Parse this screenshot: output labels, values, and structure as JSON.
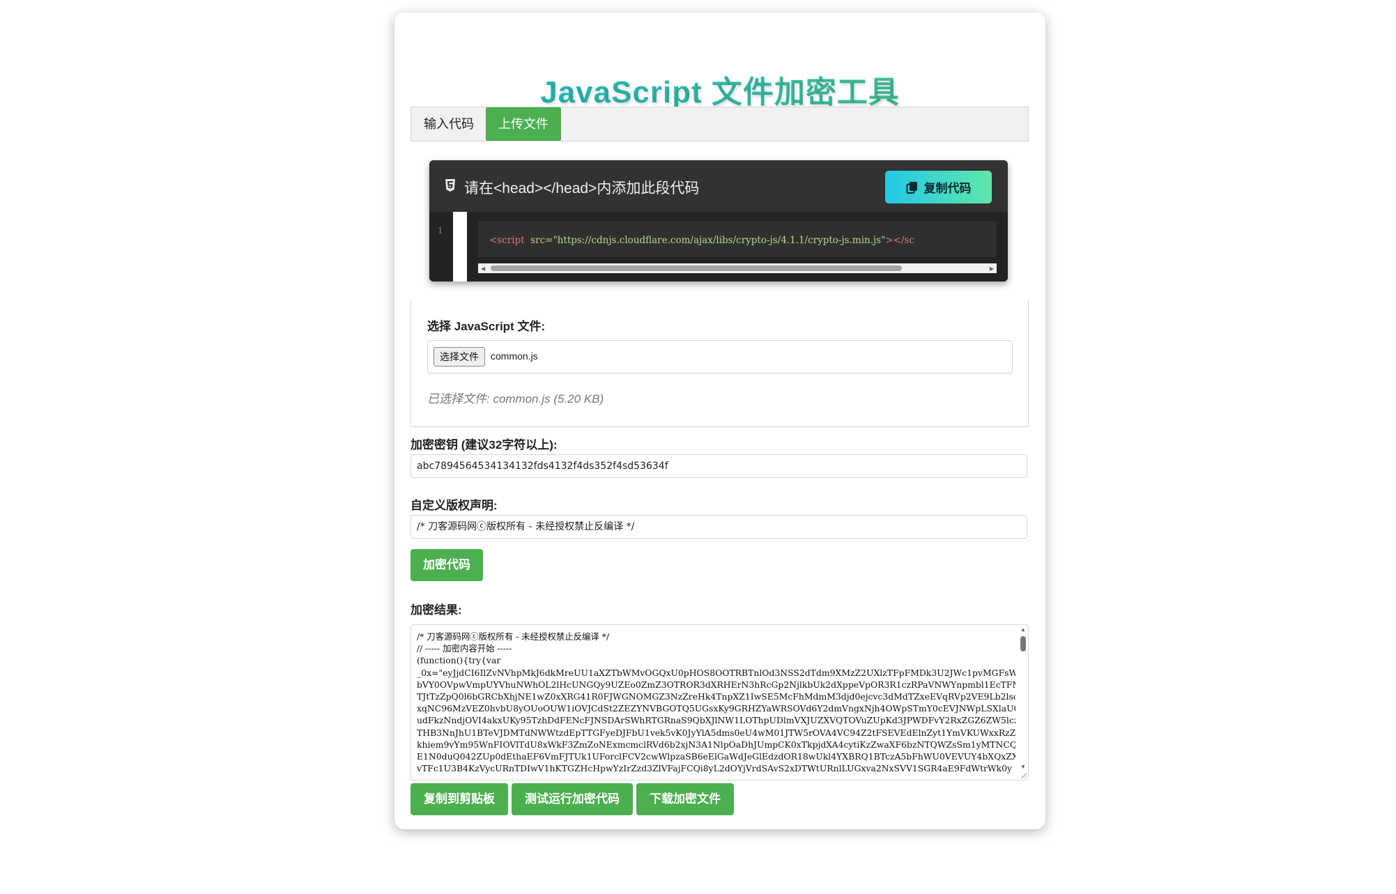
{
  "title": "JavaScript 文件加密工具",
  "tabs": [
    {
      "label": "输入代码"
    },
    {
      "label": "上传文件"
    }
  ],
  "code_snippet": {
    "title": "请在<head></head>内添加此段代码",
    "copy_label": "复制代码",
    "line_number": "1",
    "tag_open": "<script",
    "attr": "src=",
    "url": "\"https://cdnjs.cloudflare.com/ajax/libs/crypto-js/4.1.1/crypto-js.min.js\"",
    "tag_close": "></sc"
  },
  "upload": {
    "label": "选择 JavaScript 文件:",
    "button_label": "选择文件",
    "file_name": "common.js",
    "selected_text": "已选择文件: common.js (5.20 KB)"
  },
  "key": {
    "label": "加密密钥 (建议32字符以上):",
    "value": "abc7894564534134132fds4132f4ds352f4sd53634f"
  },
  "copyright": {
    "label": "自定义版权声明:",
    "value": "/* 刀客源码网ⓒ版权所有 - 未经授权禁止反编译 */"
  },
  "encrypt_button": "加密代码",
  "result": {
    "label": "加密结果:",
    "text": "/* 刀客源码网ⓒ版权所有 - 未经授权禁止反编译 */\n// ----- 加密内容开始 -----\n(function(){try{var\n_0x=\"eyJjdCI6IlZvNVhpMkJ6dkMreUU1aXZTbWMvOGQxU0pHOS8OOTRBTnlOd3NSS2dTdm9XMzZ2UXlzTFpFMDk3U2JWc1pvMGFsWVJ1\nbVY0OVpwVmpUYVhuNWhOL2lHcUNGQy9UZEo0ZmZ3OTROR3dXRHErN3hRcGp2NjlkbUk2dXppeVpOR3R1czRPaVNWYnpmbl1EcTFMSEVvO\nTJtTzZpQ0l6bGRCbXhjNE1wZ0xXRG41R0FJWGNOMGZ3NzZreHk4TnpXZ1IwSE5McFhMdmM3djd0ejcvc3dMdTZxeEVqRVp2VE9Lb2lscO\nxqNC96MzVEZ0hvbU8yOUoOUW1iOVJCdSt2ZEZYNVBGOTQ5UGsxKy9GRHZYaWRSOVd6Y2dmVngxNjh4OWpSTmY0cEVJNWpLSXlaU0EvUC9\nudFkzNndjOVI4akxUKy95TzhDdFENcFJNSDArSWhRTGRnaS9QbXJlNW1LOThpUDlmVXJUZXVQTOVuZUpKd3JPWDFvY2RxZGZ6ZW5lczNy\nTHB3NnJhU1BTeVJDMTdNWWtzdEpTTGFyeDJFbU1vek5vK0JyYlA5dms0eU4wM01JTW5rOVA4VC94Z2tFSEVEdElnZyt1YmVKUWxxRzZ2c\nkhiem9vYm95WnFIOVlTdU8xWkF3ZmZoNExmcmclRVd6b2xjN3A1NlpOaDhJUmpCK0xTkpjdXA4cytiKzZwaXF6bzNTQWZsSm1yMTNCQk\nE1N0duQ042ZUp0dEthaEF6VmFJTUk1UForclFCV2cwWlpzaSB6eElGaWdJeGlEdzdOR18wUkl4YXBRQ1BTczA5bFhWU0VEVUY4bXQxZXd\nvTFc1U3B4KzVycURnTDIwV1hKTGZHcHpwYzIrZzd3ZlVFajFCQi8yL2dOYjVrdSAvS2xDTWtURnlLUGxva2NxSVV1SGR4aE9FdWtrWk0y"
  },
  "actions": {
    "copy_clipboard": "复制到剪贴板",
    "test_run": "测试运行加密代码",
    "download": "下载加密文件"
  },
  "colors": {
    "accent_green": "#4caf50",
    "title_gradient_start": "#1fb7c9",
    "title_gradient_end": "#4cc38a"
  }
}
